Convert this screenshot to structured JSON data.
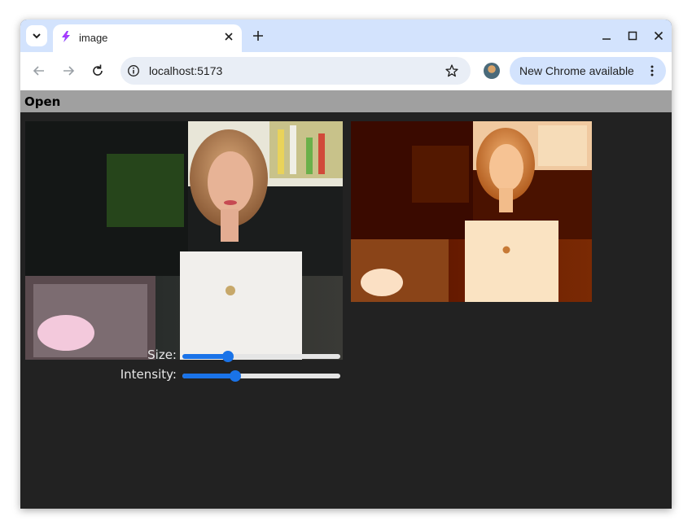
{
  "browser": {
    "tab_title": "image",
    "url": "localhost:5173",
    "update_label": "New Chrome available"
  },
  "app": {
    "menu_open": "Open",
    "controls": {
      "size_label": "Size:",
      "size_value": 0.27,
      "intensity_label": "Intensity:",
      "intensity_value": 0.32
    }
  },
  "colors": {
    "accent": "#1a73e8",
    "app_bg": "#222222",
    "menubar_bg": "#a0a0a0",
    "tabbar_bg": "#d3e3fd"
  },
  "icons": [
    "chevron-down-icon",
    "vite-favicon-icon",
    "close-icon",
    "plus-icon",
    "minimize-icon",
    "maximize-icon",
    "window-close-icon",
    "back-arrow-icon",
    "forward-arrow-icon",
    "reload-icon",
    "site-info-icon",
    "star-icon",
    "profile-avatar",
    "more-vert-icon"
  ]
}
